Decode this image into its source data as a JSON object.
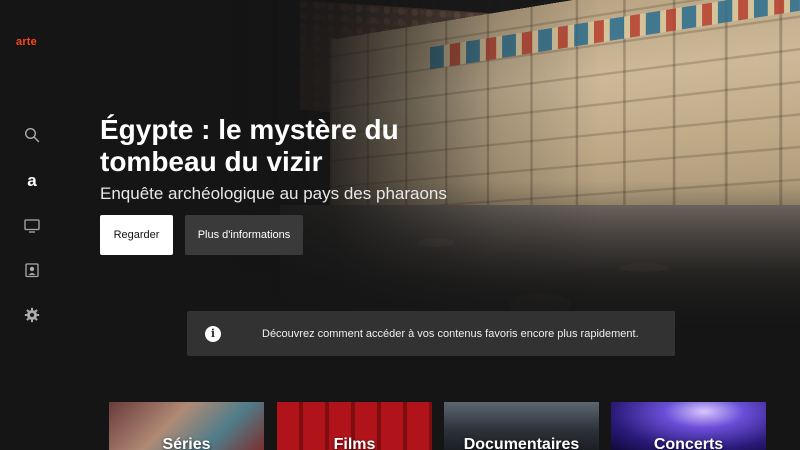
{
  "brand": {
    "logo": "arte",
    "accent": "#fa481c"
  },
  "sidebar": {
    "items": [
      {
        "icon": "search-icon"
      },
      {
        "icon": "arte-home-icon"
      },
      {
        "icon": "tv-icon"
      },
      {
        "icon": "profile-icon"
      },
      {
        "icon": "gear-icon"
      }
    ]
  },
  "hero": {
    "title": "Égypte : le mystère du tombeau du vizir",
    "subtitle": "Enquête archéologique au pays des pharaons",
    "primary_label": "Regarder",
    "secondary_label": "Plus d'informations"
  },
  "notice": {
    "icon": "info-icon",
    "text": "Découvrez comment accéder à vos contenus favoris encore plus rapidement."
  },
  "categories": [
    {
      "label": "Séries"
    },
    {
      "label": "Films"
    },
    {
      "label": "Documentaires"
    },
    {
      "label": "Concerts"
    }
  ]
}
